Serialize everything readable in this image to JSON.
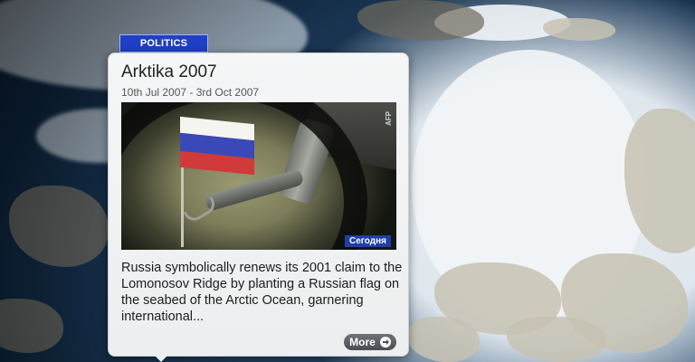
{
  "category": {
    "label": "POLITICS"
  },
  "event": {
    "title": "Arktika 2007",
    "dates": "10th Jul 2007 - 3rd Oct 2007",
    "description": "Russia symbolically renews its 2001 claim to the Lomonosov Ridge by planting a Russian flag on the seabed of the Arctic Ocean, garnering international...",
    "image_credit": "AFP",
    "image_caption": "Сегодня",
    "more_label": "More"
  },
  "icons": {
    "more": "arrow-right-icon"
  }
}
